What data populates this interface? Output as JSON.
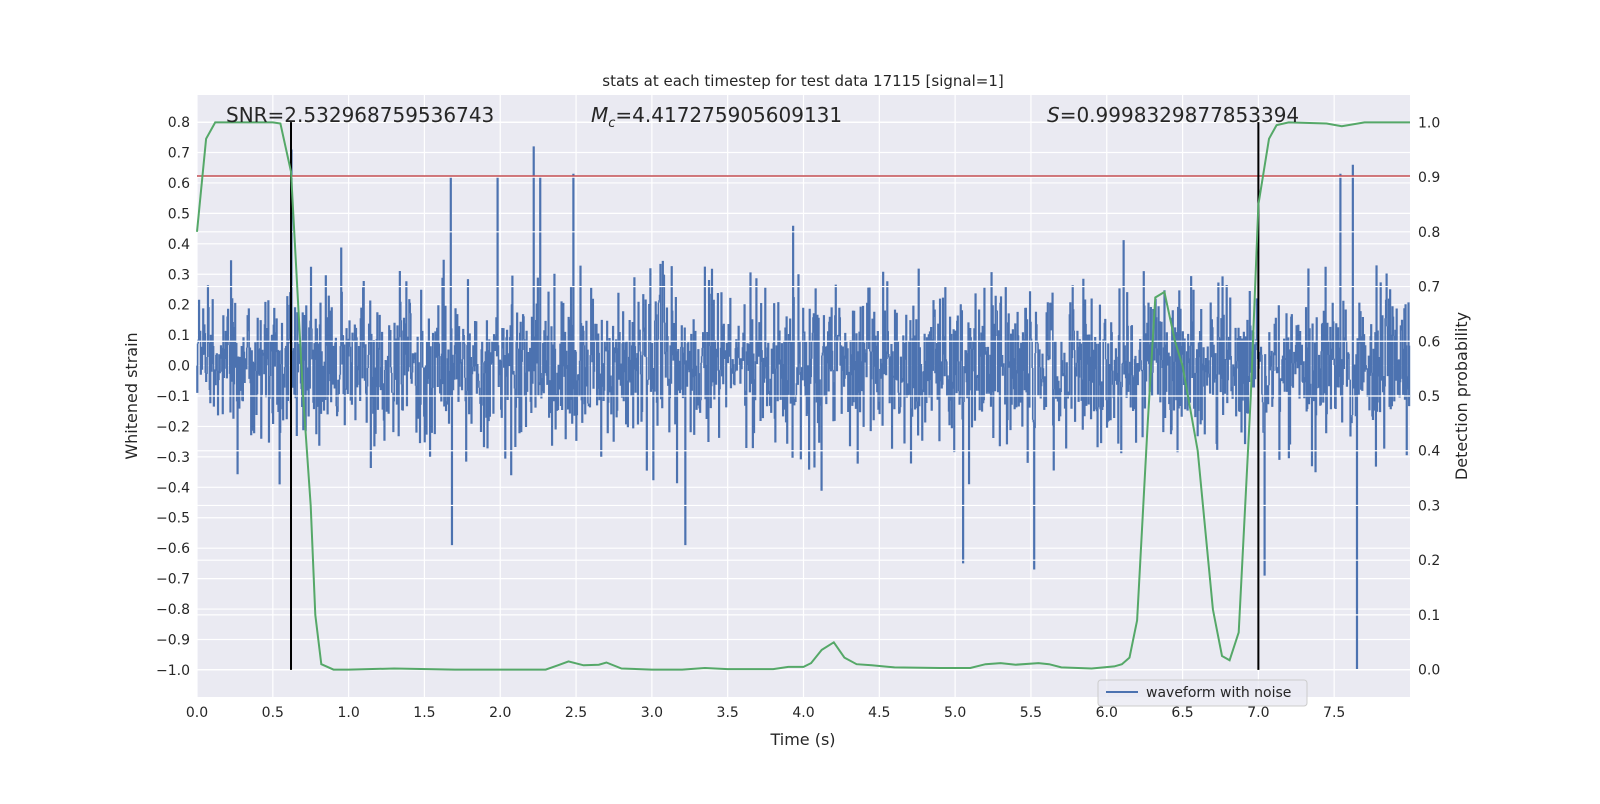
{
  "chart_data": {
    "type": "line",
    "title": "stats at each timestep for test data 17115 [signal=1]",
    "xlabel": "Time (s)",
    "ylabel": "Whitened strain",
    "y2label": "Detection probability",
    "xlim": [
      0,
      8
    ],
    "ylim": [
      -1.089,
      0.889
    ],
    "y2lim": [
      -0.05,
      1.05
    ],
    "xticks": [
      "0.0",
      "0.5",
      "1.0",
      "1.5",
      "2.0",
      "2.5",
      "3.0",
      "3.5",
      "4.0",
      "4.5",
      "5.0",
      "5.5",
      "6.0",
      "6.5",
      "7.0",
      "7.5"
    ],
    "yticks": [
      "0.8",
      "0.7",
      "0.6",
      "0.5",
      "0.4",
      "0.3",
      "0.2",
      "0.1",
      "0.0",
      "−0.1",
      "−0.2",
      "−0.3",
      "−0.4",
      "−0.5",
      "−0.6",
      "−0.7",
      "−0.8",
      "−0.9",
      "−1.0"
    ],
    "y2ticks": [
      "0.0",
      "0.1",
      "0.2",
      "0.3",
      "0.4",
      "0.5",
      "0.6",
      "0.7",
      "0.8",
      "0.9",
      "1.0"
    ],
    "grid": true,
    "legend": {
      "placement": "lower-right",
      "entries": [
        "waveform with noise"
      ]
    },
    "annotations": {
      "snr": "SNR=2.532968759536743",
      "mc_symbol": "M",
      "mc_sub": "c",
      "mc_value": "=4.417275905609131",
      "s_symbol": "S",
      "s_value": "=0.9998329877853394"
    },
    "threshold_line": {
      "y": 0.623,
      "color": "#c44e52"
    },
    "vertical_lines": {
      "x": [
        0.62,
        7.0
      ],
      "ymin": -1.0,
      "ymax": 0.8,
      "color": "#000000"
    },
    "waveform": {
      "name": "waveform with noise",
      "color": "#4c72b0",
      "sample_rate": 256,
      "duration": 8,
      "noise_std": 0.13,
      "notable_peaks": [
        {
          "x": 0.62,
          "y": 0.71
        },
        {
          "x": 1.67,
          "y": 0.62
        },
        {
          "x": 1.98,
          "y": 0.62
        },
        {
          "x": 2.22,
          "y": 0.72
        },
        {
          "x": 2.26,
          "y": 0.62
        },
        {
          "x": 2.48,
          "y": 0.63
        },
        {
          "x": 7.54,
          "y": 0.63
        },
        {
          "x": 7.62,
          "y": 0.66
        },
        {
          "x": 7.65,
          "y": 0.8
        },
        {
          "x": 1.68,
          "y": -0.59
        },
        {
          "x": 3.22,
          "y": -0.59
        },
        {
          "x": 5.05,
          "y": -0.65
        },
        {
          "x": 5.52,
          "y": -0.67
        },
        {
          "x": 7.04,
          "y": -0.69
        },
        {
          "x": 7.65,
          "y": -1.0
        }
      ]
    },
    "detection_probability": {
      "color": "#55a868",
      "x": [
        0,
        0.06,
        0.12,
        0.2,
        0.3,
        0.4,
        0.5,
        0.55,
        0.62,
        0.7,
        0.75,
        0.78,
        0.82,
        0.9,
        1.0,
        1.3,
        1.7,
        2.0,
        2.3,
        2.38,
        2.45,
        2.55,
        2.65,
        2.7,
        2.8,
        3.0,
        3.2,
        3.35,
        3.5,
        3.8,
        3.9,
        4.0,
        4.05,
        4.12,
        4.2,
        4.27,
        4.35,
        4.45,
        4.6,
        4.9,
        5.1,
        5.2,
        5.3,
        5.4,
        5.55,
        5.62,
        5.7,
        5.9,
        6.05,
        6.1,
        6.15,
        6.2,
        6.27,
        6.32,
        6.38,
        6.45,
        6.5,
        6.6,
        6.7,
        6.76,
        6.81,
        6.87,
        6.95,
        7.0,
        7.07,
        7.12,
        7.2,
        7.45,
        7.55,
        7.7,
        8.0
      ],
      "y": [
        0.8,
        0.97,
        1.0,
        1.0,
        1.0,
        1.0,
        1.0,
        0.998,
        0.91,
        0.5,
        0.3,
        0.1,
        0.01,
        0.0,
        0.0,
        0.002,
        0.0,
        0.0,
        0.0,
        0.008,
        0.015,
        0.008,
        0.009,
        0.013,
        0.002,
        0.0,
        0.0,
        0.003,
        0.001,
        0.001,
        0.005,
        0.005,
        0.012,
        0.036,
        0.05,
        0.022,
        0.01,
        0.008,
        0.004,
        0.003,
        0.003,
        0.01,
        0.012,
        0.009,
        0.012,
        0.01,
        0.004,
        0.002,
        0.006,
        0.01,
        0.022,
        0.09,
        0.45,
        0.68,
        0.69,
        0.6,
        0.555,
        0.4,
        0.11,
        0.025,
        0.017,
        0.068,
        0.5,
        0.85,
        0.97,
        0.995,
        1.0,
        0.998,
        0.993,
        1.0,
        1.0
      ]
    }
  }
}
